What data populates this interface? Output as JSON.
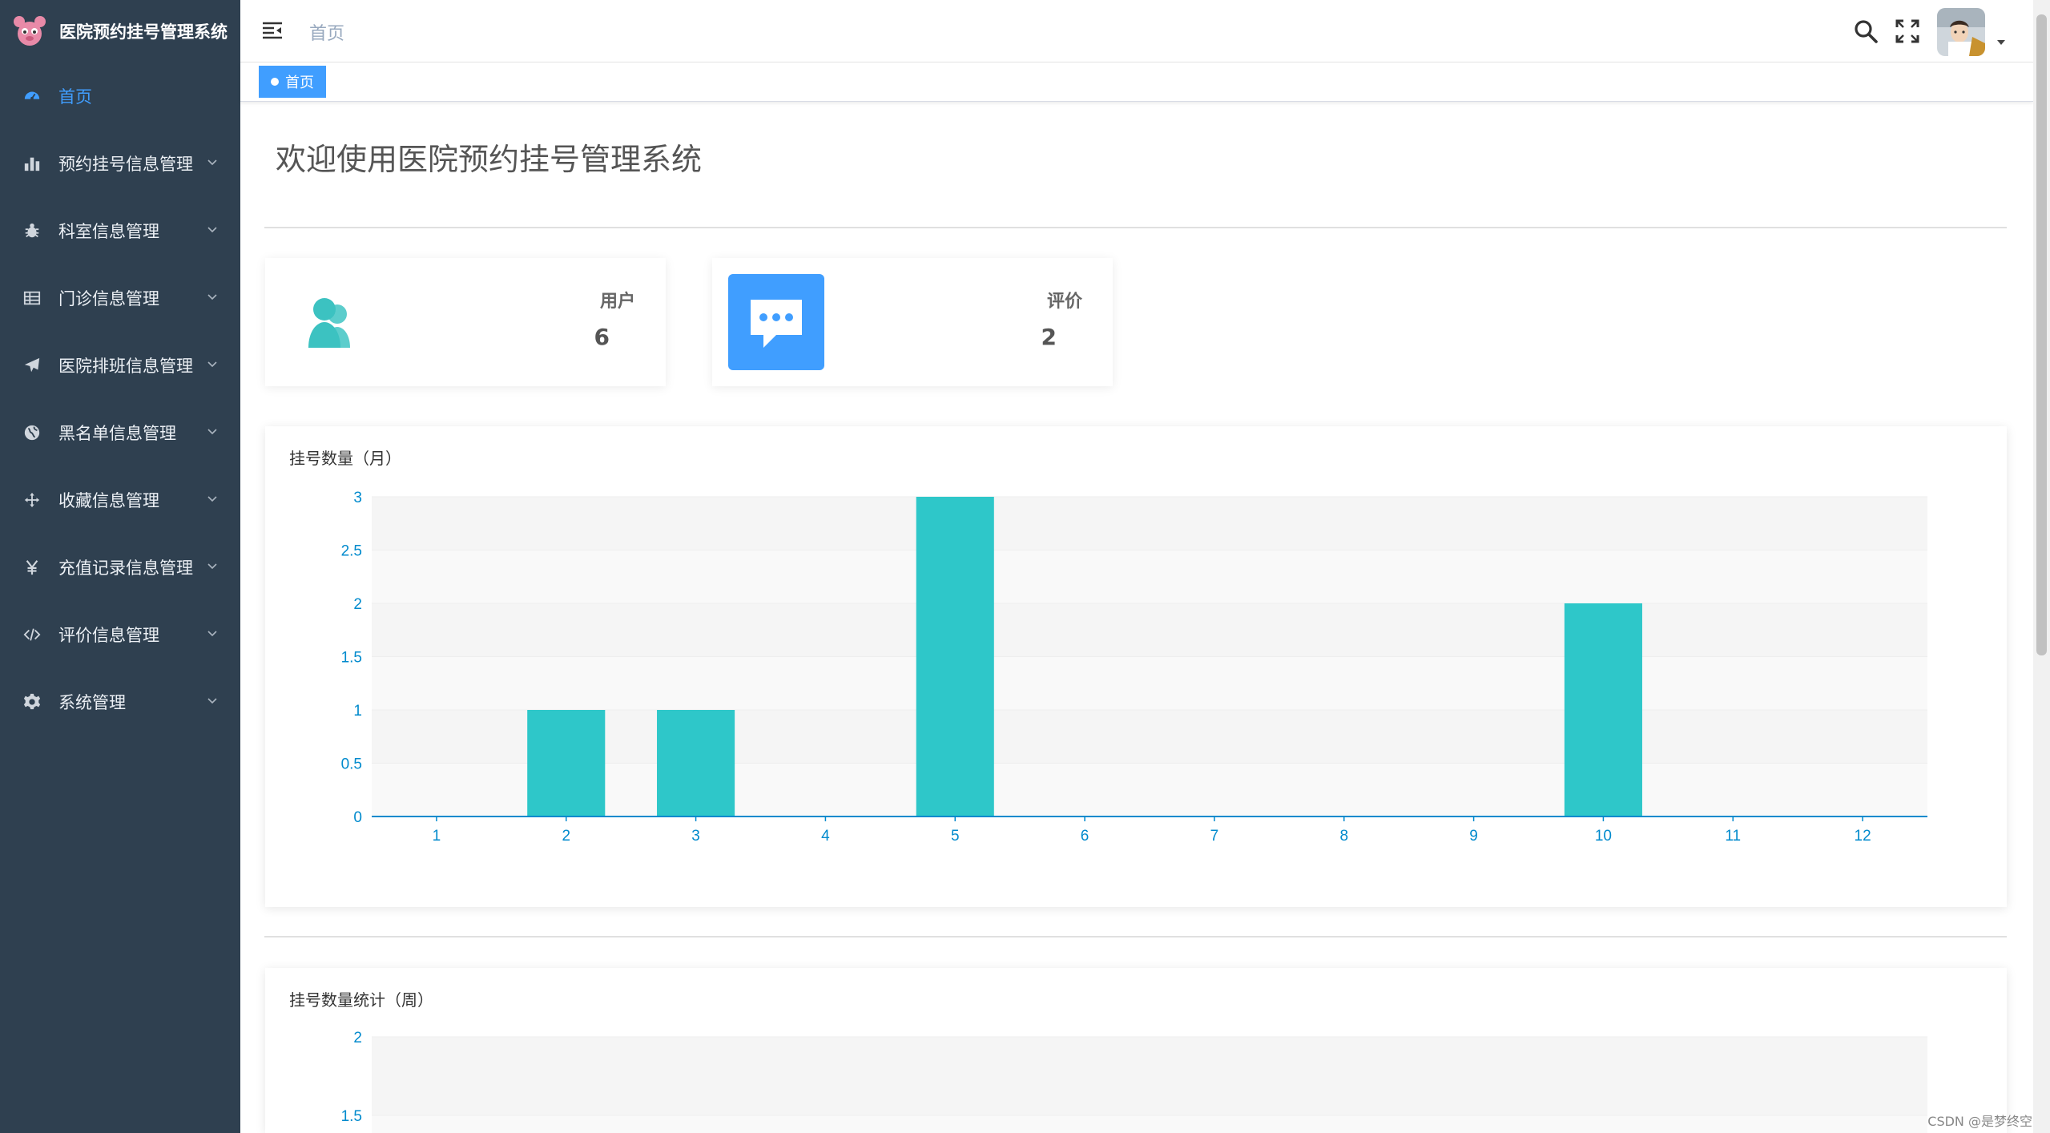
{
  "app": {
    "title": "医院预约挂号管理系统",
    "logo_icon": "paw-logo-icon"
  },
  "sidebar": {
    "items": [
      {
        "label": "首页",
        "icon": "dashboard-icon",
        "active": true
      },
      {
        "label": "预约挂号信息管理",
        "icon": "bar-chart-icon"
      },
      {
        "label": "科室信息管理",
        "icon": "bug-icon"
      },
      {
        "label": "门诊信息管理",
        "icon": "table-icon"
      },
      {
        "label": "医院排班信息管理",
        "icon": "paper-plane-icon"
      },
      {
        "label": "黑名单信息管理",
        "icon": "globe-icon"
      },
      {
        "label": "收藏信息管理",
        "icon": "move-icon"
      },
      {
        "label": "充值记录信息管理",
        "icon": "yen-icon"
      },
      {
        "label": "评价信息管理",
        "icon": "code-icon"
      },
      {
        "label": "系统管理",
        "icon": "gear-icon"
      }
    ]
  },
  "header": {
    "breadcrumb": "首页"
  },
  "tags_view": {
    "active_tag": "首页"
  },
  "main": {
    "welcome": "欢迎使用医院预约挂号管理系统",
    "stats": [
      {
        "label": "用户",
        "value": "6",
        "icon": "users-icon",
        "color": "#3cc2c1"
      },
      {
        "label": "评价",
        "value": "2",
        "icon": "chat-bubble-icon",
        "color": "#409eff"
      }
    ]
  },
  "chart_data": [
    {
      "type": "bar",
      "title": "挂号数量（月）",
      "categories": [
        "1",
        "2",
        "3",
        "4",
        "5",
        "6",
        "7",
        "8",
        "9",
        "10",
        "11",
        "12"
      ],
      "values": [
        0,
        1,
        1,
        0,
        3,
        0,
        0,
        0,
        0,
        2,
        0,
        0
      ],
      "ylim": [
        0,
        3
      ],
      "yticks": [
        "0",
        "0.5",
        "1",
        "1.5",
        "2",
        "2.5",
        "3"
      ],
      "color": "#2ec7c9",
      "axis_color": "#008acd",
      "grid": true
    },
    {
      "type": "bar",
      "title": "挂号数量统计（周）",
      "categories": [],
      "values": [],
      "ylim": [
        0,
        2
      ],
      "yticks_visible": [
        "2",
        "1.5"
      ],
      "color": "#2ec7c9",
      "axis_color": "#008acd",
      "grid": true
    }
  ],
  "watermark": "CSDN @是梦终空"
}
